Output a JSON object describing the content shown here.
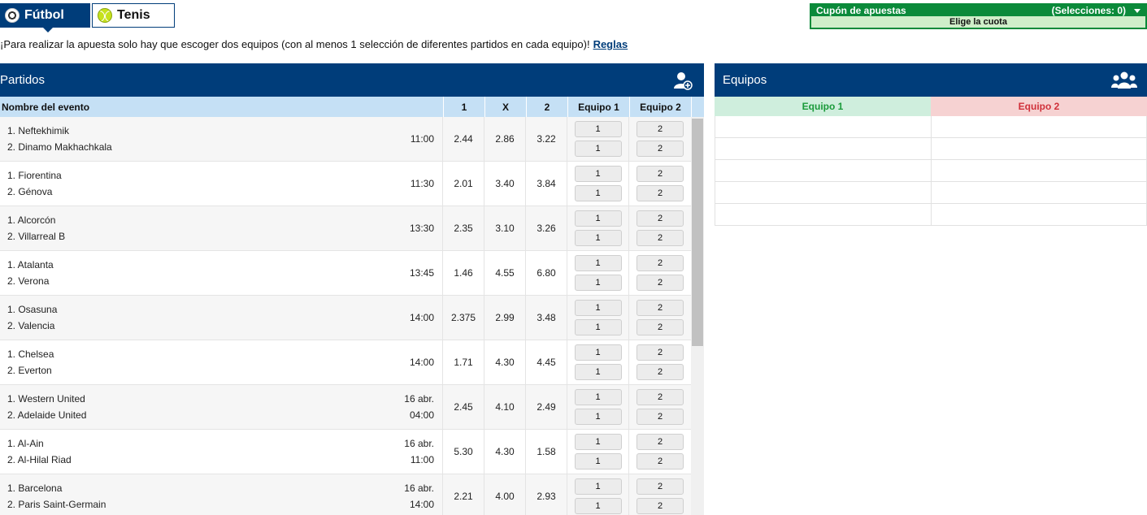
{
  "tabs": [
    {
      "label": "Fútbol",
      "icon": "soccer-ball-icon",
      "active": true
    },
    {
      "label": "Tenis",
      "icon": "tennis-ball-icon",
      "active": false
    }
  ],
  "coupon": {
    "title": "Cupón de apuestas",
    "selections": "(Selecciones: 0)",
    "subtitle": "Elige la cuota"
  },
  "info": {
    "text": "¡Para realizar la apuesta solo hay que escoger dos equipos (con al menos 1 selección de diferentes partidos en cada equipo)!",
    "link": "Reglas"
  },
  "partidos": {
    "title": "Partidos",
    "columns": {
      "name": "Nombre del evento",
      "o1": "1",
      "ox": "X",
      "o2": "2",
      "team1": "Equipo 1",
      "team2": "Equipo 2"
    },
    "rows": [
      {
        "a": "1. Neftekhimik",
        "b": "2. Dinamo Makhachkala",
        "date": "",
        "time": "11:00",
        "o1": "2.44",
        "ox": "2.86",
        "o2": "3.22"
      },
      {
        "a": "1. Fiorentina",
        "b": "2. Génova",
        "date": "",
        "time": "11:30",
        "o1": "2.01",
        "ox": "3.40",
        "o2": "3.84"
      },
      {
        "a": "1. Alcorcón",
        "b": "2. Villarreal B",
        "date": "",
        "time": "13:30",
        "o1": "2.35",
        "ox": "3.10",
        "o2": "3.26"
      },
      {
        "a": "1. Atalanta",
        "b": "2. Verona",
        "date": "",
        "time": "13:45",
        "o1": "1.46",
        "ox": "4.55",
        "o2": "6.80"
      },
      {
        "a": "1. Osasuna",
        "b": "2. Valencia",
        "date": "",
        "time": "14:00",
        "o1": "2.375",
        "ox": "2.99",
        "o2": "3.48"
      },
      {
        "a": "1. Chelsea",
        "b": "2. Everton",
        "date": "",
        "time": "14:00",
        "o1": "1.71",
        "ox": "4.30",
        "o2": "4.45"
      },
      {
        "a": "1. Western United",
        "b": "2. Adelaide United",
        "date": "16 abr.",
        "time": "04:00",
        "o1": "2.45",
        "ox": "4.10",
        "o2": "2.49"
      },
      {
        "a": "1. Al-Ain",
        "b": "2. Al-Hilal Riad",
        "date": "16 abr.",
        "time": "11:00",
        "o1": "5.30",
        "ox": "4.30",
        "o2": "1.58"
      },
      {
        "a": "1. Barcelona",
        "b": "2. Paris Saint-Germain",
        "date": "16 abr.",
        "time": "14:00",
        "o1": "2.21",
        "ox": "4.00",
        "o2": "2.93"
      }
    ],
    "pick1": "1",
    "pick2": "2"
  },
  "equipos": {
    "title": "Equipos",
    "team1": "Equipo 1",
    "team2": "Equipo 2",
    "slots": 5
  }
}
